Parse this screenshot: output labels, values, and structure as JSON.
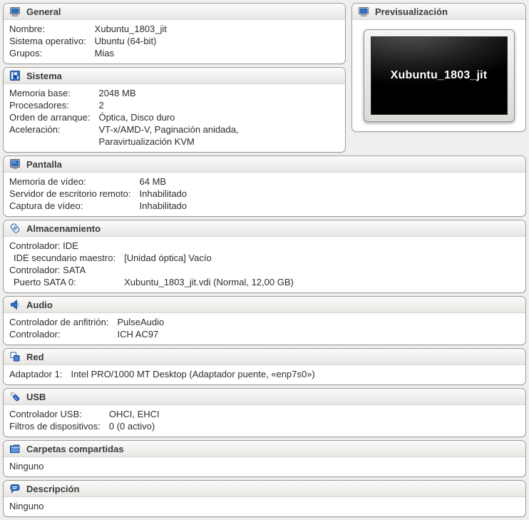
{
  "colors": {
    "icon_blue": "#2f6fc4",
    "icon_blue_dark": "#1d4d8f",
    "page_background": "#f0efed",
    "preview_screen_background": "#000000"
  },
  "preview": {
    "title": "Previsualización",
    "icon": "monitor-icon",
    "screen_text": "Xubuntu_1803_jit"
  },
  "sections": {
    "general": {
      "title": "General",
      "icon": "monitor-icon",
      "rows": [
        {
          "label": "Nombre:",
          "value": "Xubuntu_1803_jit"
        },
        {
          "label": "Sistema operativo:",
          "value": "Ubuntu (64-bit)"
        },
        {
          "label": "Grupos:",
          "value": "Mias"
        }
      ]
    },
    "sistema": {
      "title": "Sistema",
      "icon": "chip-icon",
      "rows": [
        {
          "label": "Memoria base:",
          "value": "2048 MB"
        },
        {
          "label": "Procesadores:",
          "value": "2"
        },
        {
          "label": "Orden de arranque:",
          "value": "Óptica, Disco duro"
        },
        {
          "label": "Aceleración:",
          "value": "VT-x/AMD-V, Paginación anidada, Paravirtualización KVM"
        }
      ]
    },
    "pantalla": {
      "title": "Pantalla",
      "icon": "display-icon",
      "rows": [
        {
          "label": "Memoria de vídeo:",
          "value": "64 MB"
        },
        {
          "label": "Servidor de escritorio remoto:",
          "value": "Inhabilitado"
        },
        {
          "label": "Captura de vídeo:",
          "value": "Inhabilitado"
        }
      ]
    },
    "almacenamiento": {
      "title": "Almacenamiento",
      "icon": "disk-icon",
      "rows": [
        {
          "label": "Controlador: IDE",
          "value": ""
        },
        {
          "label": "IDE secundario maestro:",
          "value": "[Unidad óptica] Vacío"
        },
        {
          "label": "Controlador: SATA",
          "value": ""
        },
        {
          "label": "Puerto SATA 0:",
          "value": "Xubuntu_1803_jit.vdi (Normal, 12,00 GB)"
        }
      ]
    },
    "audio": {
      "title": "Audio",
      "icon": "speaker-icon",
      "rows": [
        {
          "label": "Controlador de anfitrión:",
          "value": "PulseAudio"
        },
        {
          "label": "Controlador:",
          "value": "ICH AC97"
        }
      ]
    },
    "red": {
      "title": "Red",
      "icon": "network-icon",
      "rows": [
        {
          "label": "Adaptador 1:",
          "value": "Intel PRO/1000 MT Desktop (Adaptador puente, «enp7s0»)"
        }
      ]
    },
    "usb": {
      "title": "USB",
      "icon": "usb-icon",
      "rows": [
        {
          "label": "Controlador USB:",
          "value": "OHCI, EHCI"
        },
        {
          "label": "Filtros de dispositivos:",
          "value": "0 (0 activo)"
        }
      ]
    },
    "carpetas": {
      "title": "Carpetas compartidas",
      "icon": "folder-icon",
      "empty_text": "Ninguno"
    },
    "descripcion": {
      "title": "Descripción",
      "icon": "speech-bubble-icon",
      "empty_text": "Ninguno"
    }
  }
}
